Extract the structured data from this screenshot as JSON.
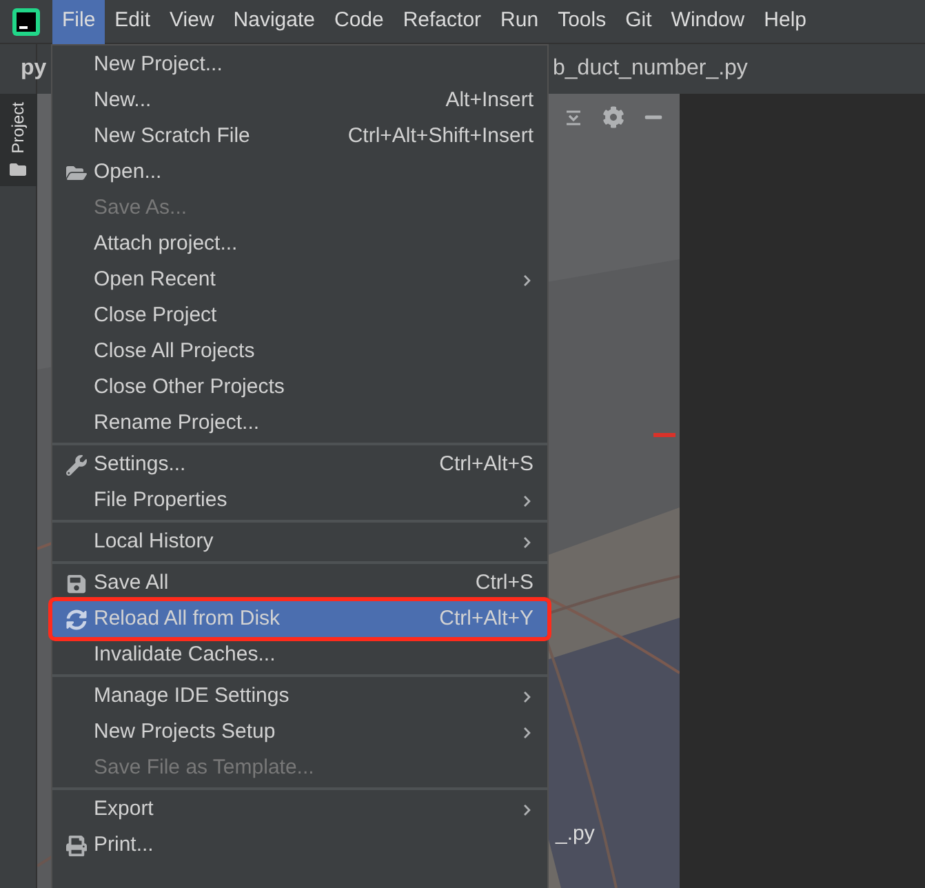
{
  "menubar": [
    {
      "label": "File",
      "selected": true
    },
    {
      "label": "Edit",
      "selected": false
    },
    {
      "label": "View",
      "selected": false
    },
    {
      "label": "Navigate",
      "selected": false
    },
    {
      "label": "Code",
      "selected": false
    },
    {
      "label": "Refactor",
      "selected": false
    },
    {
      "label": "Run",
      "selected": false
    },
    {
      "label": "Tools",
      "selected": false
    },
    {
      "label": "Git",
      "selected": false
    },
    {
      "label": "Window",
      "selected": false
    },
    {
      "label": "Help",
      "selected": false
    }
  ],
  "sidebar": {
    "tab": {
      "label": "Project",
      "selected": true
    }
  },
  "tab_bar": {
    "tabs": [
      {
        "label": "py"
      },
      {
        "label": "b_duct_number_.py"
      }
    ]
  },
  "project_panel": {
    "visible_item": "_.py"
  },
  "menu": {
    "groups": [
      [
        {
          "label": "New Project...",
          "kind": "plain",
          "submenu": false,
          "disabled": false,
          "selected": false,
          "marked": false
        },
        {
          "label": "New...",
          "shortcut": "Alt+Insert",
          "kind": "plain",
          "submenu": false,
          "disabled": false,
          "selected": false,
          "marked": false
        },
        {
          "label": "New Scratch File",
          "shortcut": "Ctrl+Alt+Shift+Insert",
          "kind": "plain",
          "submenu": false,
          "disabled": false,
          "selected": false,
          "marked": false
        },
        {
          "label": "Open...",
          "kind": "folder",
          "submenu": false,
          "disabled": false,
          "selected": false,
          "marked": false
        },
        {
          "label": "Save As...",
          "kind": "plain",
          "submenu": false,
          "disabled": true,
          "selected": false,
          "marked": false
        },
        {
          "label": "Attach project...",
          "kind": "plain",
          "submenu": false,
          "disabled": false,
          "selected": false,
          "marked": false
        },
        {
          "label": "Open Recent",
          "kind": "plain",
          "submenu": true,
          "disabled": false,
          "selected": false,
          "marked": false
        },
        {
          "label": "Close Project",
          "kind": "plain",
          "submenu": false,
          "disabled": false,
          "selected": false,
          "marked": false
        },
        {
          "label": "Close All Projects",
          "kind": "plain",
          "submenu": false,
          "disabled": false,
          "selected": false,
          "marked": false
        },
        {
          "label": "Close Other Projects",
          "kind": "plain",
          "submenu": false,
          "disabled": false,
          "selected": false,
          "marked": false
        },
        {
          "label": "Rename Project...",
          "kind": "plain",
          "submenu": false,
          "disabled": false,
          "selected": false,
          "marked": false
        }
      ],
      [
        {
          "label": "Settings...",
          "shortcut": "Ctrl+Alt+S",
          "kind": "wrench",
          "submenu": false,
          "disabled": false,
          "selected": false,
          "marked": false
        },
        {
          "label": "File Properties",
          "kind": "plain",
          "submenu": true,
          "disabled": false,
          "selected": false,
          "marked": false
        }
      ],
      [
        {
          "label": "Local History",
          "kind": "plain",
          "submenu": true,
          "disabled": false,
          "selected": false,
          "marked": false
        }
      ],
      [
        {
          "label": "Save All",
          "shortcut": "Ctrl+S",
          "kind": "save",
          "submenu": false,
          "disabled": false,
          "selected": false,
          "marked": false
        },
        {
          "label": "Reload All from Disk",
          "shortcut": "Ctrl+Alt+Y",
          "kind": "reload",
          "submenu": false,
          "disabled": false,
          "selected": true,
          "marked": true
        },
        {
          "label": "Invalidate Caches...",
          "kind": "plain",
          "submenu": false,
          "disabled": false,
          "selected": false,
          "marked": false
        }
      ],
      [
        {
          "label": "Manage IDE Settings",
          "kind": "plain",
          "submenu": true,
          "disabled": false,
          "selected": false,
          "marked": false
        },
        {
          "label": "New Projects Setup",
          "kind": "plain",
          "submenu": true,
          "disabled": false,
          "selected": false,
          "marked": false
        },
        {
          "label": "Save File as Template...",
          "kind": "plain",
          "submenu": false,
          "disabled": true,
          "selected": false,
          "marked": false
        }
      ],
      [
        {
          "label": "Export",
          "kind": "plain",
          "submenu": true,
          "disabled": false,
          "selected": false,
          "marked": false
        },
        {
          "label": "Print...",
          "kind": "print",
          "submenu": false,
          "disabled": false,
          "selected": false,
          "marked": false
        }
      ]
    ]
  }
}
